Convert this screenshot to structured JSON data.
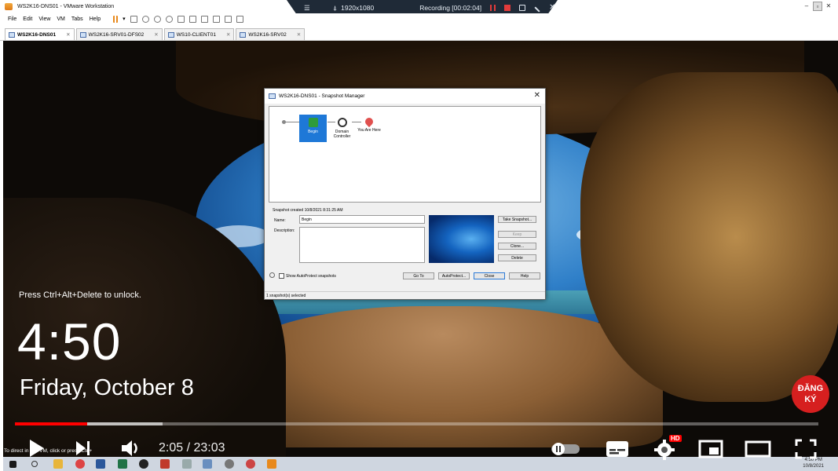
{
  "window": {
    "title": "WS2K16-DNS01 - VMware Workstation"
  },
  "recorder": {
    "resolution": "1920x1080",
    "status": "Recording [00:02:04]"
  },
  "menu": [
    "File",
    "Edit",
    "View",
    "VM",
    "Tabs",
    "Help"
  ],
  "tabs": [
    {
      "label": "WS2K16-DNS01",
      "active": true
    },
    {
      "label": "WS2K16-SRV01-DFS02",
      "active": false
    },
    {
      "label": "WS10-CLIENT01",
      "active": false
    },
    {
      "label": "WS2K16-SRV02",
      "active": false
    }
  ],
  "lockscreen": {
    "hint": "Press Ctrl+Alt+Delete to unlock.",
    "time": "4:50",
    "date": "Friday, October 8"
  },
  "snapshot_manager": {
    "title": "WS2K16-DNS01 - Snapshot Manager",
    "nodes": [
      {
        "label": "Begin",
        "selected": true
      },
      {
        "label": "Domain Controller",
        "selected": false
      },
      {
        "label": "You Are Here",
        "selected": false
      }
    ],
    "created": "Snapshot created 10/8/2021 8:31:25 AM",
    "name_label": "Name:",
    "name_value": "Begin",
    "description_label": "Description:",
    "buttons": {
      "take": "Take Snapshot...",
      "keep": "Keep",
      "clone": "Clone...",
      "delete": "Delete",
      "goto": "Go To",
      "autoprotect": "AutoProtect...",
      "close": "Close",
      "help": "Help"
    },
    "checkbox_label": "Show AutoProtect snapshots",
    "status": "1 snapshot(s) selected"
  },
  "player": {
    "time": "2:05 / 23:03",
    "progress_played": 0.09,
    "progress_buffered": 0.184,
    "subscribe": "ĐĂNG KÝ",
    "hd_badge": "HD"
  },
  "vm_hint": "To direct in       this VM, click      or press Ctrl+",
  "taskbar_clock": {
    "time": "4:50 PM",
    "date": "10/8/2021"
  },
  "colors": {
    "accent_red": "#ff0000",
    "selection_blue": "#1e78d7"
  }
}
